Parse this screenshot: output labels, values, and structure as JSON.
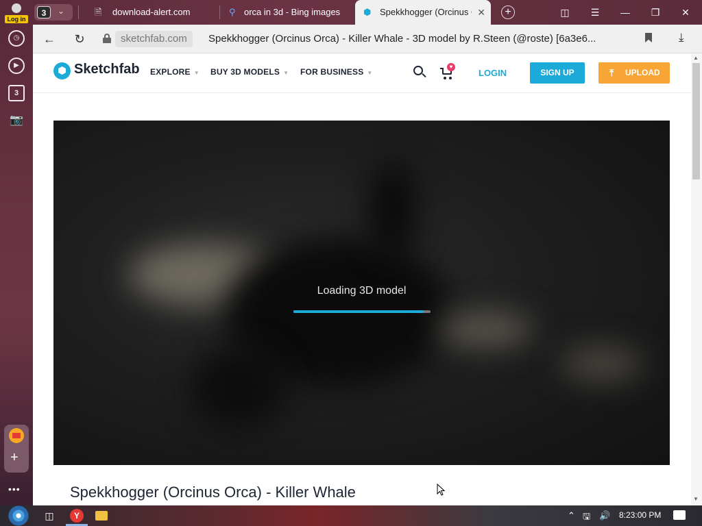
{
  "browser": {
    "profile_login_label": "Log in",
    "tab_group_count": "3",
    "tabs": [
      {
        "label": "download-alert.com",
        "icon": "document-icon"
      },
      {
        "label": "orca in 3d - Bing images",
        "icon": "search-icon"
      },
      {
        "label": "Spekkhogger (Orcinus O",
        "icon": "sketchfab-icon",
        "active": true
      }
    ],
    "address": {
      "domain": "sketchfab.com",
      "title": "Spekkhogger (Orcinus Orca) - Killer Whale - 3D model by R.Steen (@roste) [6a3e6..."
    },
    "sidebar": {
      "icons": [
        "history-icon",
        "play-icon",
        "tab-count-icon",
        "camera-icon"
      ],
      "tab_badge": "3",
      "more_label": "•••"
    }
  },
  "site": {
    "logo_text": "Sketchfab",
    "nav": {
      "explore": "EXPLORE",
      "buy": "BUY 3D MODELS",
      "business": "FOR BUSINESS"
    },
    "cart_badge": "♥",
    "login": "LOGIN",
    "signup": "SIGN UP",
    "upload": "UPLOAD"
  },
  "viewer": {
    "loading_text": "Loading 3D model",
    "progress": 0.95
  },
  "model": {
    "title": "Spekkhogger (Orcinus Orca) - Killer Whale"
  },
  "taskbar": {
    "clock": "8:23:00 PM"
  },
  "colors": {
    "accent": "#1caad9",
    "upload": "#f7a534",
    "badge": "#e83e6e"
  }
}
